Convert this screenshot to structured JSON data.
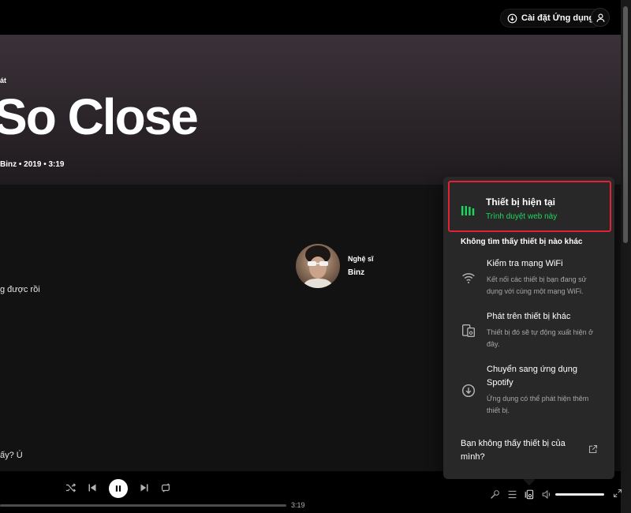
{
  "header": {
    "install_label": "Cài đặt Ứng dụng",
    "install_icon": "download-circle-icon",
    "user_icon": "user-icon"
  },
  "track": {
    "type_label": "át",
    "title": "So Close",
    "meta": "Binz • 2019 • 3:19"
  },
  "lyrics": {
    "line1": "g được rồi",
    "line2": "ấy? Ú"
  },
  "artist": {
    "label": "Nghệ sĩ",
    "name": "Binz"
  },
  "player": {
    "duration": "3:19",
    "icons": [
      "shuffle-icon",
      "previous-icon",
      "pause-icon",
      "next-icon",
      "repeat-icon",
      "microphone-icon",
      "queue-icon",
      "connect-device-icon",
      "volume-icon",
      "fullscreen-icon"
    ],
    "progress": 0
  },
  "devices": {
    "current_title": "Thiết bị hiện tại",
    "current_subtitle": "Trình duyệt web này",
    "none_found": "Không tìm thấy thiết bị nào khác",
    "items": [
      {
        "title": "Kiểm tra mạng WiFi",
        "desc": "Kết nối các thiết bị bạn đang sử dụng với cùng một mạng WiFi.",
        "icon": "wifi-icon"
      },
      {
        "title": "Phát trên thiết bị khác",
        "desc": "Thiết bị đó sẽ tự động xuất hiện ở đây.",
        "icon": "devices-icon"
      },
      {
        "title": "Chuyển sang ứng dụng Spotify",
        "desc": "Ứng dụng có thể phát hiện thêm thiết bị.",
        "icon": "download-circle-icon"
      }
    ],
    "help_link": "Bạn không thấy thiết bị của mình?",
    "accent": "#1ed760",
    "highlight": "#e22134"
  }
}
